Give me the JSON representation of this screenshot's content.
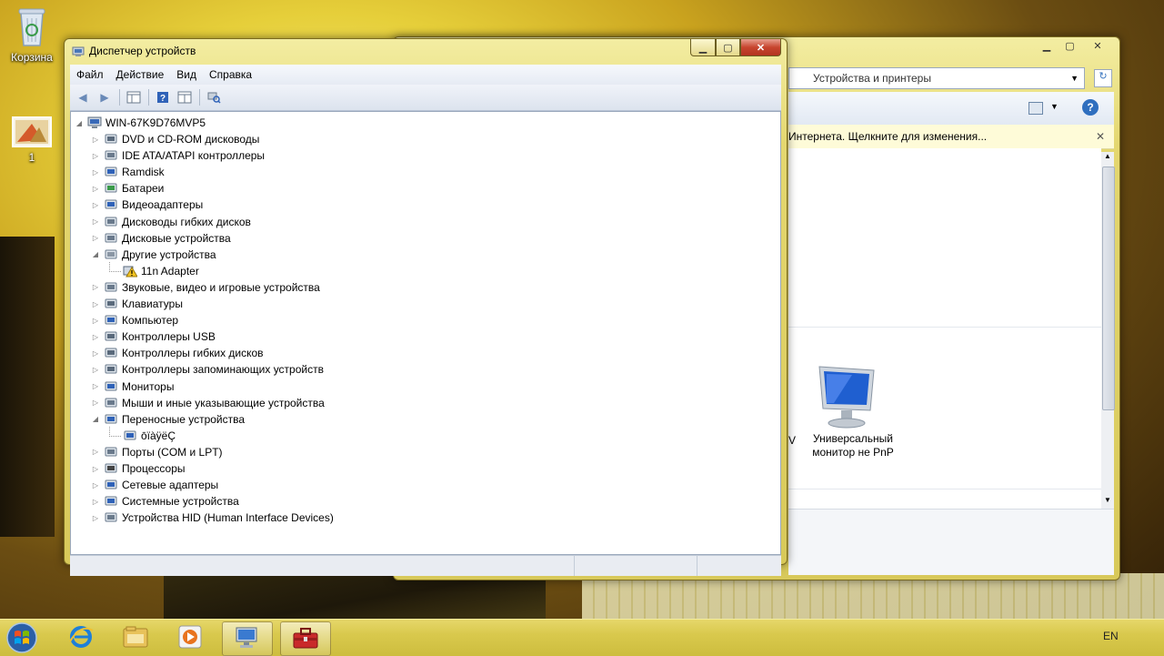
{
  "desktop": {
    "icons": [
      {
        "label": "Корзина"
      },
      {
        "label": "1"
      }
    ]
  },
  "device_manager": {
    "title": "Диспетчер устройств",
    "menu": [
      "Файл",
      "Действие",
      "Вид",
      "Справка"
    ],
    "tree": {
      "root": "WIN-67K9D76MVP5",
      "items": [
        {
          "label": "DVD и CD-ROM дисководы",
          "expanded": false
        },
        {
          "label": "IDE ATA/ATAPI контроллеры",
          "expanded": false
        },
        {
          "label": "Ramdisk",
          "expanded": false
        },
        {
          "label": "Батареи",
          "expanded": false
        },
        {
          "label": "Видеоадаптеры",
          "expanded": false
        },
        {
          "label": "Дисководы гибких дисков",
          "expanded": false
        },
        {
          "label": "Дисковые устройства",
          "expanded": false
        },
        {
          "label": "Другие устройства",
          "expanded": true
        },
        {
          "label": "11n Adapter",
          "child": true,
          "warning": true
        },
        {
          "label": "Звуковые, видео и игровые устройства",
          "expanded": false
        },
        {
          "label": "Клавиатуры",
          "expanded": false
        },
        {
          "label": "Компьютер",
          "expanded": false
        },
        {
          "label": "Контроллеры USB",
          "expanded": false
        },
        {
          "label": "Контроллеры гибких дисков",
          "expanded": false
        },
        {
          "label": "Контроллеры запоминающих устройств",
          "expanded": false
        },
        {
          "label": "Мониторы",
          "expanded": false
        },
        {
          "label": "Мыши и иные указывающие устройства",
          "expanded": false
        },
        {
          "label": "Переносные устройства",
          "expanded": true
        },
        {
          "label": "ōïàÿëÇ",
          "child": true,
          "warning": false
        },
        {
          "label": "Порты (COM и LPT)",
          "expanded": false
        },
        {
          "label": "Процессоры",
          "expanded": false
        },
        {
          "label": "Сетевые адаптеры",
          "expanded": false
        },
        {
          "label": "Системные устройства",
          "expanded": false
        },
        {
          "label": "Устройства HID (Human Interface Devices)",
          "expanded": false
        }
      ]
    }
  },
  "devices_printers": {
    "address": "Устройства и принтеры",
    "infobar": "Интернета. Щелкните для изменения...",
    "device_label_line1": "Универсальный",
    "device_label_line2": "монитор не PnP",
    "partial_label": "V"
  },
  "taskbar": {
    "language": "EN"
  },
  "colors": {
    "accent": "#e0d15a",
    "close": "#c7452f"
  }
}
